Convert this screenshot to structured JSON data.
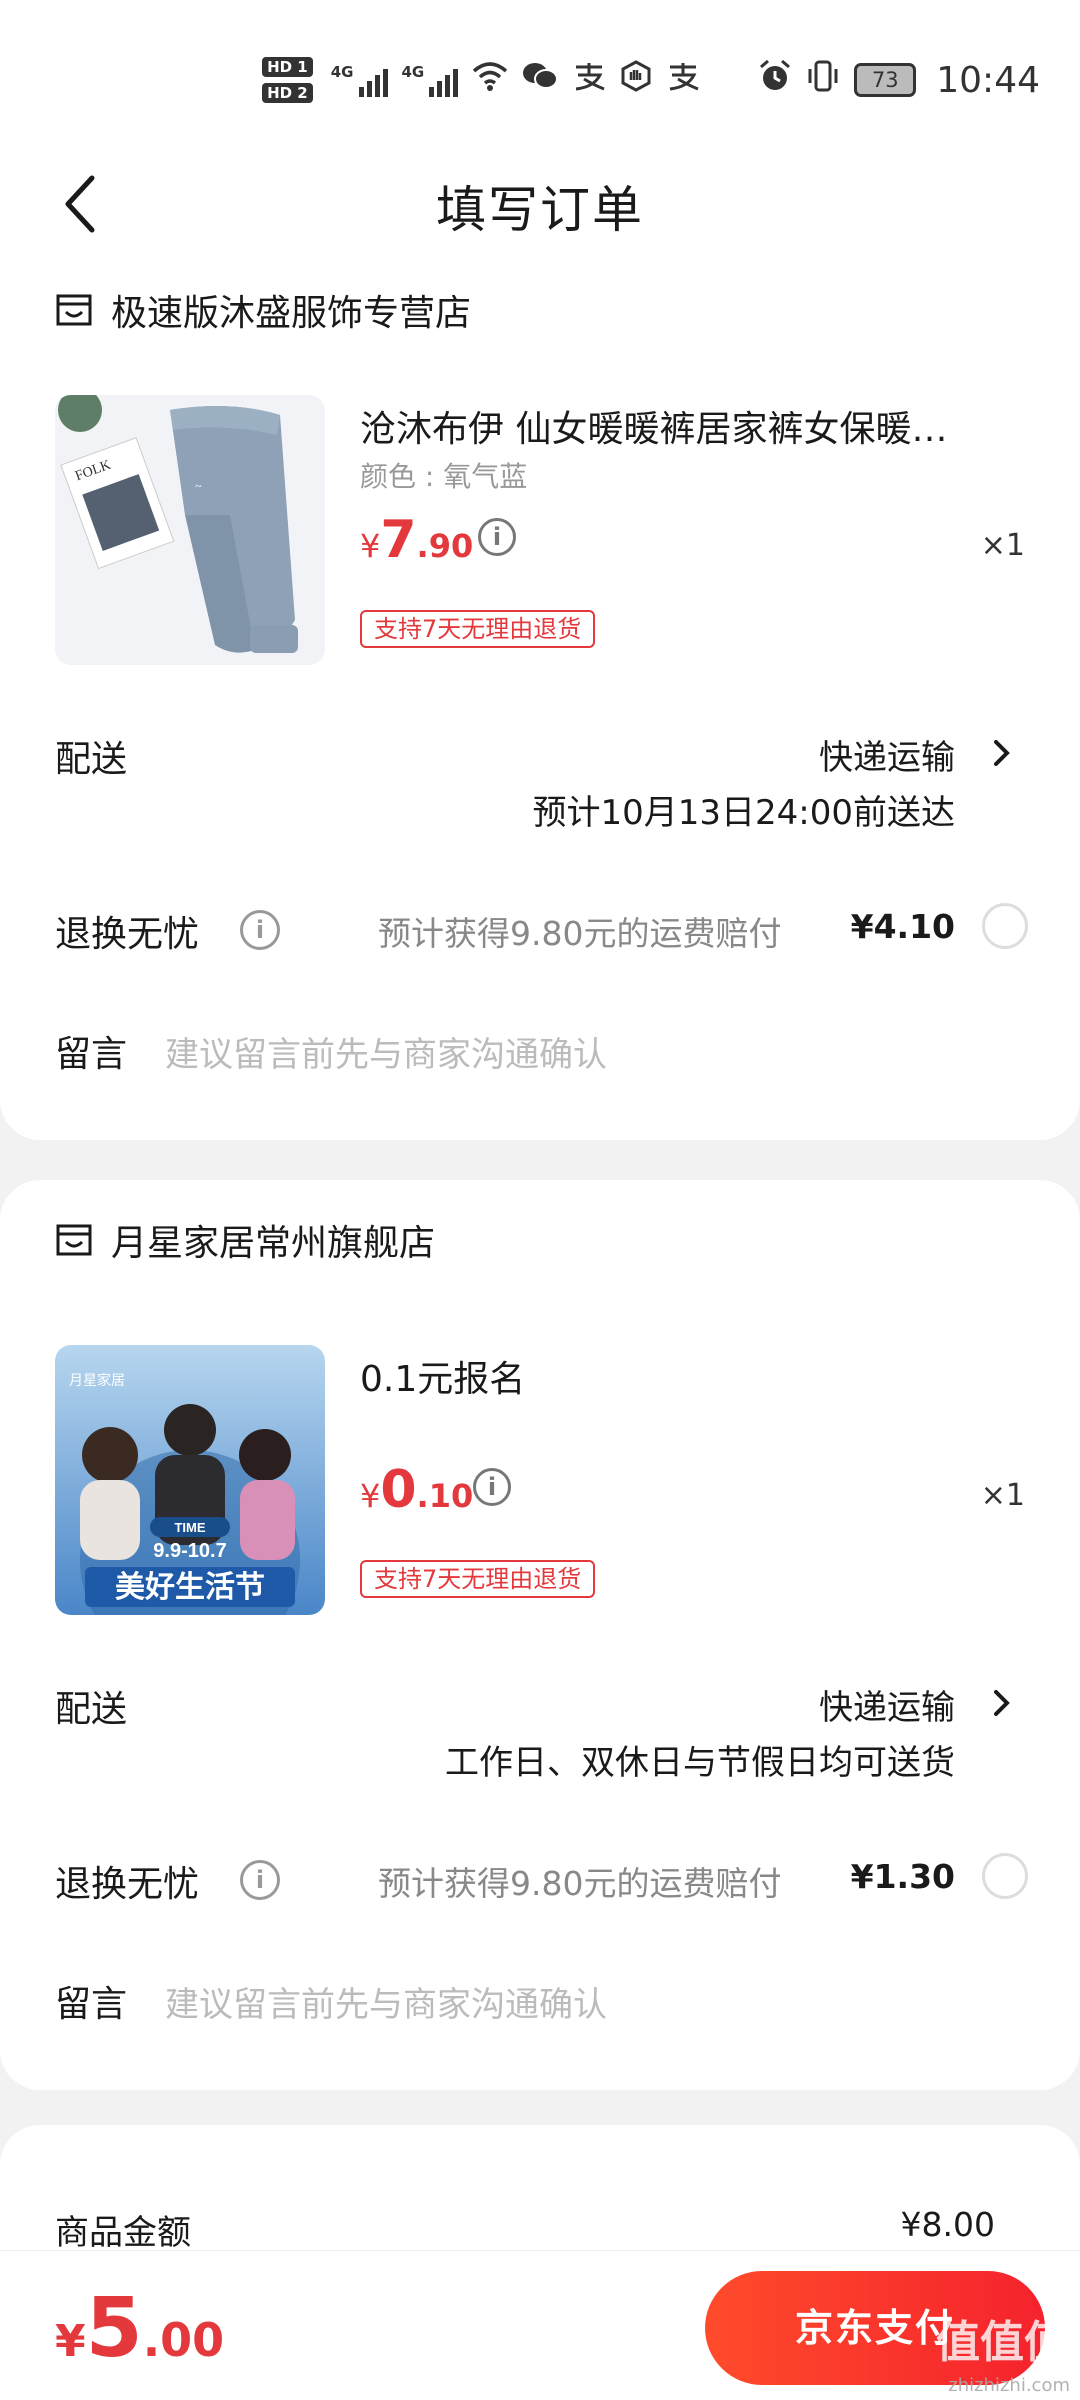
{
  "status_bar": {
    "hd1": "HD 1",
    "hd2": "HD 2",
    "net1": "4G",
    "net2": "4G",
    "battery": "73",
    "time": "10:44"
  },
  "header": {
    "title": "填写订单"
  },
  "orders": [
    {
      "store_name": "极速版沐盛服饰专营店",
      "product_title": "沧沐布伊 仙女暖暖裤居家裤女保暖…",
      "product_spec": "颜色 : 氧气蓝",
      "price_symbol": "¥",
      "price_int": "7",
      "price_dec": ".90",
      "qty": "×1",
      "return_tag": "支持7天无理由退货",
      "delivery_label": "配送",
      "delivery_method": "快递运输",
      "delivery_note": "预计10月13日24:00前送达",
      "guard_label": "退换无忧",
      "guard_desc": "预计获得9.80元的运费赔付",
      "guard_price": "¥4.10",
      "msg_label": "留言",
      "msg_placeholder": "建议留言前先与商家沟通确认"
    },
    {
      "store_name": "月星家居常州旗舰店",
      "product_title": "0.1元报名",
      "price_symbol": "¥",
      "price_int": "0",
      "price_dec": ".10",
      "qty": "×1",
      "return_tag": "支持7天无理由退货",
      "delivery_label": "配送",
      "delivery_method": "快递运输",
      "delivery_note": "工作日、双休日与节假日均可送货",
      "guard_label": "退换无忧",
      "guard_desc": "预计获得9.80元的运费赔付",
      "guard_price": "¥1.30",
      "msg_label": "留言",
      "msg_placeholder": "建议留言前先与商家沟通确认",
      "img_brand": "月星家居",
      "img_time": "TIME",
      "img_dates": "9.9-10.7",
      "img_banner": "美好生活节"
    }
  ],
  "summary": {
    "goods_label": "商品金额",
    "goods_value": "¥8.00"
  },
  "bottom": {
    "total_symbol": "¥",
    "total_int": "5",
    "total_dec": ".00",
    "pay_label": "京东支付",
    "watermark": "值值值",
    "watermark_sub": "zhizhizhi.com"
  },
  "colors": {
    "accent_red": "#e4393c",
    "pay_gradient_start": "#ff4b2b",
    "pay_gradient_end": "#f5222d"
  }
}
